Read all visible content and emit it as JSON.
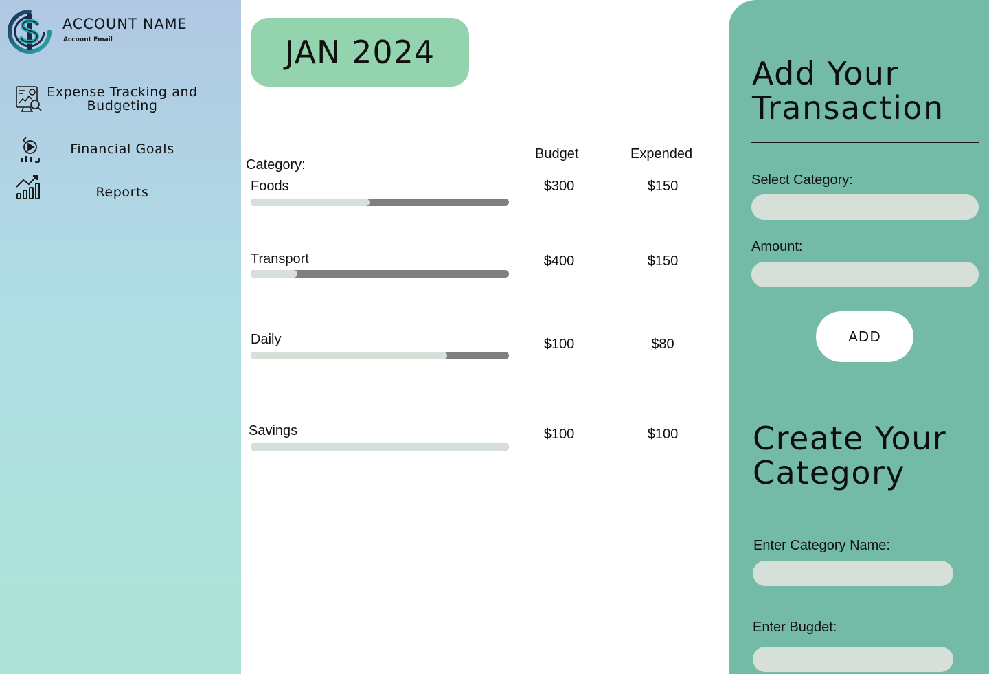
{
  "account": {
    "name": "ACCOUNT NAME",
    "email": "Account Email"
  },
  "nav": [
    {
      "label": "Expense Tracking and Budgeting",
      "icon": "expense-tracking-icon"
    },
    {
      "label": "Financial Goals",
      "icon": "financial-goals-icon"
    },
    {
      "label": "Reports",
      "icon": "reports-icon"
    }
  ],
  "month": "JAN 2024",
  "table": {
    "headers": {
      "category": "Category:",
      "budget": "Budget",
      "expended": "Expended"
    },
    "rows": [
      {
        "category": "Foods",
        "budget": "$300",
        "expended": "$150",
        "progress": 0.46
      },
      {
        "category": "Transport",
        "budget": "$400",
        "expended": "$150",
        "progress": 0.18
      },
      {
        "category": "Daily",
        "budget": "$100",
        "expended": "$80",
        "progress": 0.76
      },
      {
        "category": "Savings",
        "budget": "$100",
        "expended": "$100",
        "progress": 1.0
      }
    ]
  },
  "add_transaction": {
    "title_line1": "Add Your",
    "title_line2": "Transaction",
    "category_label": "Select Category:",
    "category_value": "",
    "amount_label": "Amount:",
    "amount_value": "",
    "add_label": "ADD"
  },
  "create_category": {
    "title_line1": "Create Your",
    "title_line2": "Category",
    "name_label": "Enter Category Name:",
    "name_value": "",
    "budget_label": "Enter Bugdet:",
    "budget_value": ""
  },
  "colors": {
    "sidebar_top": "#b1c8e3",
    "sidebar_bottom": "#ade3d6",
    "month_pill": "#93d3ae",
    "panel": "#74bba7",
    "input_bg": "#d7dfd9",
    "bar_track": "#7f7f7f",
    "bar_fill": "#d7dfd9"
  }
}
